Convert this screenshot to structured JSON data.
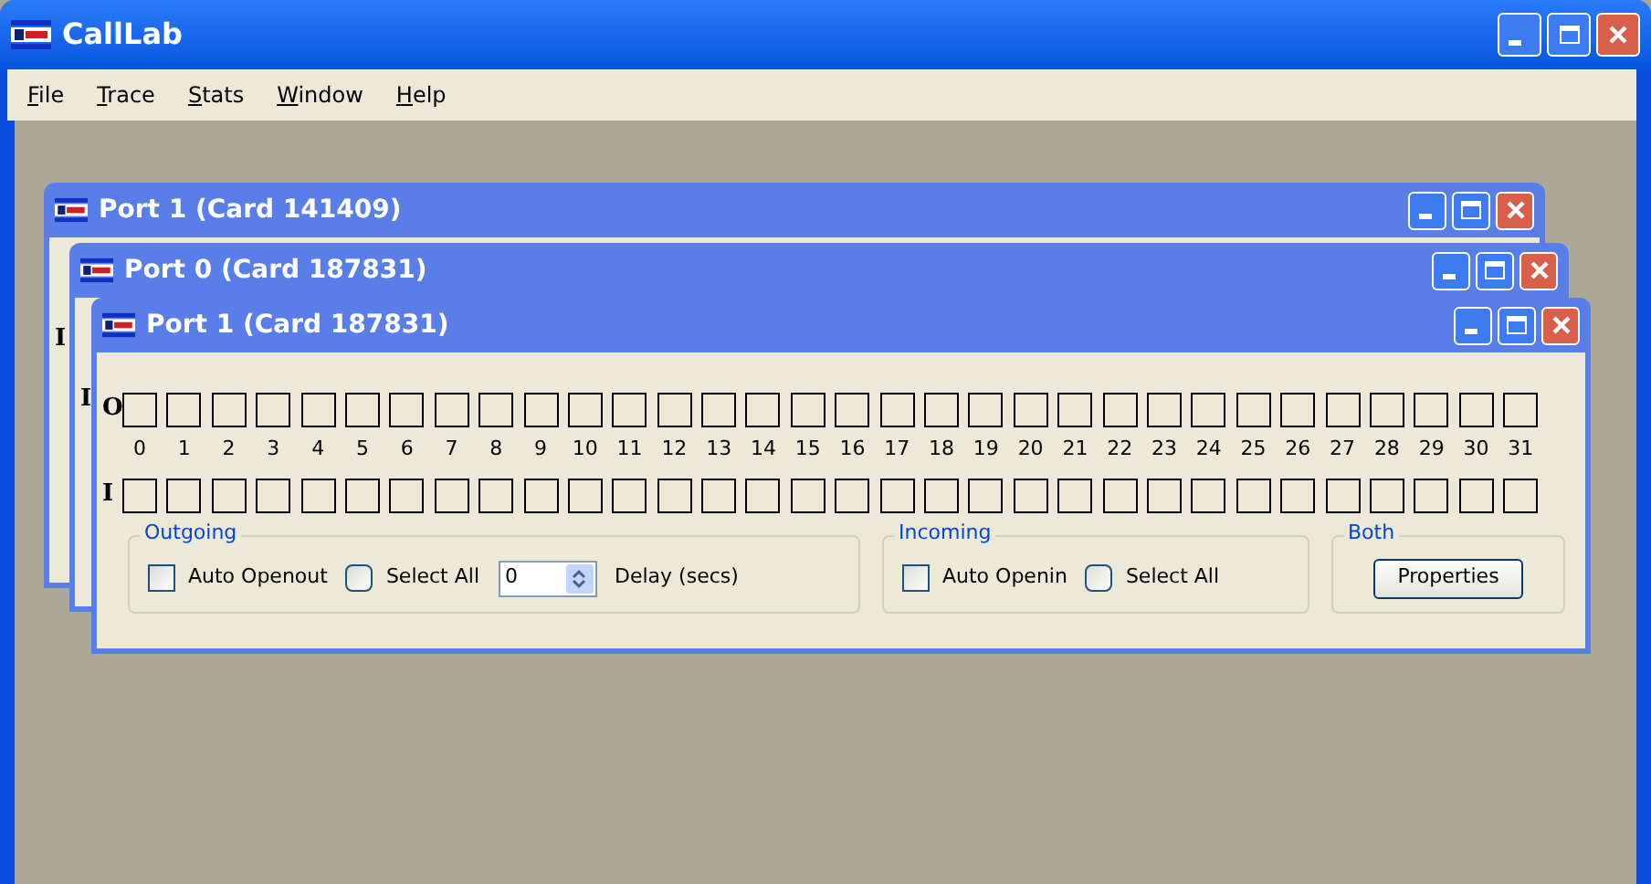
{
  "window": {
    "title": "CallLab"
  },
  "menu": [
    "File",
    "Trace",
    "Stats",
    "Window",
    "Help"
  ],
  "child_windows": [
    {
      "title": "Port 1 (Card 141409)",
      "in_label": "I"
    },
    {
      "title": "Port 0 (Card 187831)",
      "in_label": "I"
    },
    {
      "title": "Port 1 (Card 187831)",
      "out_label": "O",
      "in_label": "I",
      "bits": [
        {
          "label": "0",
          "out": false,
          "in": false
        },
        {
          "label": "1",
          "out": false,
          "in": false
        },
        {
          "label": "2",
          "out": false,
          "in": false
        },
        {
          "label": "3",
          "out": false,
          "in": false
        },
        {
          "label": "4",
          "out": false,
          "in": false
        },
        {
          "label": "5",
          "out": false,
          "in": false
        },
        {
          "label": "6",
          "out": false,
          "in": false
        },
        {
          "label": "7",
          "out": false,
          "in": false
        },
        {
          "label": "8",
          "out": false,
          "in": false
        },
        {
          "label": "9",
          "out": false,
          "in": false
        },
        {
          "label": "10",
          "out": false,
          "in": false
        },
        {
          "label": "11",
          "out": false,
          "in": false
        },
        {
          "label": "12",
          "out": false,
          "in": false
        },
        {
          "label": "13",
          "out": false,
          "in": false
        },
        {
          "label": "14",
          "out": false,
          "in": false
        },
        {
          "label": "15",
          "out": false,
          "in": false
        },
        {
          "label": "16",
          "out": false,
          "in": false
        },
        {
          "label": "17",
          "out": false,
          "in": false
        },
        {
          "label": "18",
          "out": false,
          "in": false
        },
        {
          "label": "19",
          "out": false,
          "in": false
        },
        {
          "label": "20",
          "out": false,
          "in": false
        },
        {
          "label": "21",
          "out": false,
          "in": false
        },
        {
          "label": "22",
          "out": false,
          "in": false
        },
        {
          "label": "23",
          "out": false,
          "in": false
        },
        {
          "label": "24",
          "out": false,
          "in": false
        },
        {
          "label": "25",
          "out": false,
          "in": false
        },
        {
          "label": "26",
          "out": false,
          "in": false
        },
        {
          "label": "27",
          "out": false,
          "in": false
        },
        {
          "label": "28",
          "out": false,
          "in": false
        },
        {
          "label": "29",
          "out": false,
          "in": false
        },
        {
          "label": "30",
          "out": false,
          "in": false
        },
        {
          "label": "31",
          "out": false,
          "in": false
        }
      ],
      "outgoing": {
        "title": "Outgoing",
        "auto_open": {
          "label": "Auto Openout",
          "checked": false
        },
        "select_all": {
          "label": "Select All",
          "checked": false
        },
        "delay": {
          "value": "0",
          "label": "Delay (secs)"
        }
      },
      "incoming": {
        "title": "Incoming",
        "auto_open": {
          "label": "Auto Openin",
          "checked": false
        },
        "select_all": {
          "label": "Select All",
          "checked": false
        }
      },
      "both": {
        "title": "Both",
        "button": "Properties"
      }
    }
  ]
}
